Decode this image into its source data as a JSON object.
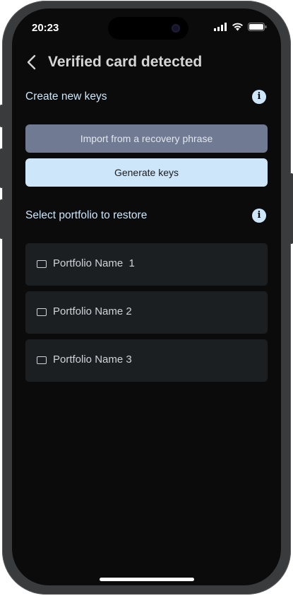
{
  "status_bar": {
    "time": "20:23"
  },
  "header": {
    "title": "Verified card detected"
  },
  "create_section": {
    "label": "Create new keys",
    "import_button": "Import from a recovery phrase",
    "generate_button": "Generate keys"
  },
  "restore_section": {
    "label": "Select portfolio to restore",
    "portfolios": [
      {
        "name": "Portfolio Name  1"
      },
      {
        "name": "Portfolio Name 2"
      },
      {
        "name": "Portfolio Name 3"
      }
    ]
  },
  "colors": {
    "accent": "#cde6fa",
    "import_button_bg": "#707a92",
    "card_bg": "#1b1f21",
    "screen_bg": "#0b0b0b"
  },
  "icons": [
    "back-chevron-icon",
    "info-icon",
    "wallet-icon",
    "signal-icon",
    "wifi-icon",
    "battery-icon"
  ]
}
